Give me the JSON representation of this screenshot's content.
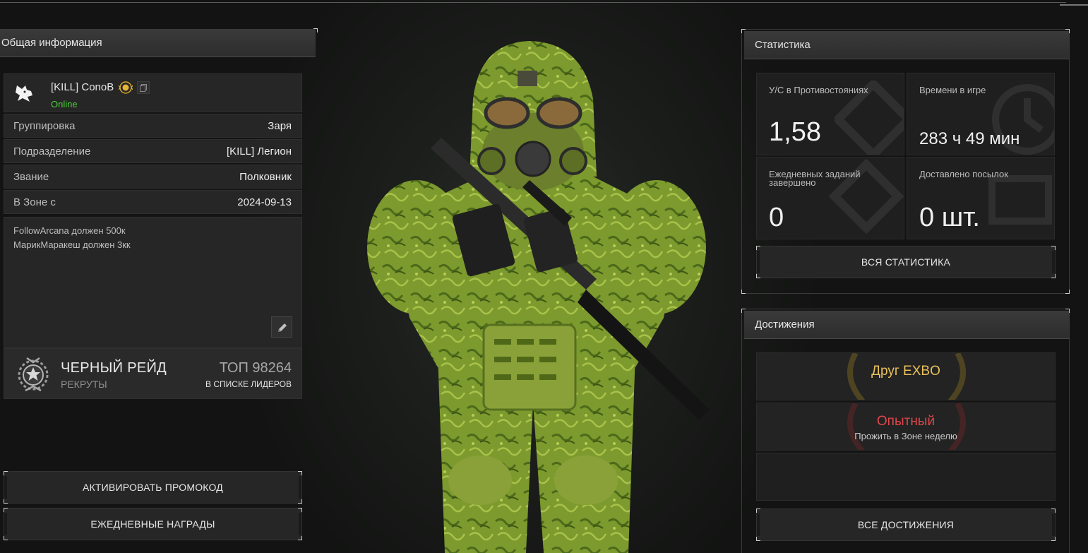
{
  "left": {
    "header": "Общая информация",
    "player": {
      "name": "[KILL] ConoB",
      "status": "Online"
    },
    "rows": [
      {
        "key": "Группировка",
        "value": "Заря"
      },
      {
        "key": "Подразделение",
        "value": "[KILL] Легион"
      },
      {
        "key": "Звание",
        "value": "Полковник"
      },
      {
        "key": "В Зоне с",
        "value": "2024-09-13"
      }
    ],
    "notes": [
      "FollowArcana должен 500к",
      "МарикМаракеш должен 3кк"
    ],
    "raid": {
      "title": "ЧЕРНЫЙ РЕЙД",
      "subtitle": "РЕКРУТЫ",
      "top": "ТОП 98264",
      "leaders": "В СПИСКЕ ЛИДЕРОВ"
    },
    "buttons": {
      "promo": "АКТИВИРОВАТЬ ПРОМОКОД",
      "daily": "ЕЖЕДНЕВНЫЕ НАГРАДЫ"
    }
  },
  "stats": {
    "header": "Статистика",
    "tiles": [
      {
        "label": "У/С в Противостояниях",
        "value": "1,58"
      },
      {
        "label": "Времени в игре",
        "value": "283 ч 49 мин"
      },
      {
        "label": "Ежедневных заданий завершено",
        "value": "0"
      },
      {
        "label": "Доставлено посылок",
        "value": "0 шт."
      }
    ],
    "all_button": "ВСЯ СТАТИСТИКА"
  },
  "achievements": {
    "header": "Достижения",
    "items": [
      {
        "title": "Друг EXBO",
        "desc": "",
        "color": "#e8c15a"
      },
      {
        "title": "Опытный",
        "desc": "Прожить в Зоне неделю",
        "color": "#e0464a"
      }
    ],
    "all_button": "ВСЕ ДОСТИЖЕНИЯ"
  },
  "colors": {
    "online": "#4cd137",
    "gold": "#e8c15a",
    "red": "#e0464a",
    "panel": "#262626"
  },
  "icons": [
    "wolf-logo-icon",
    "rank-badge-icon",
    "copy-icon",
    "edit-pencil-icon",
    "black-raid-emblem-icon"
  ]
}
